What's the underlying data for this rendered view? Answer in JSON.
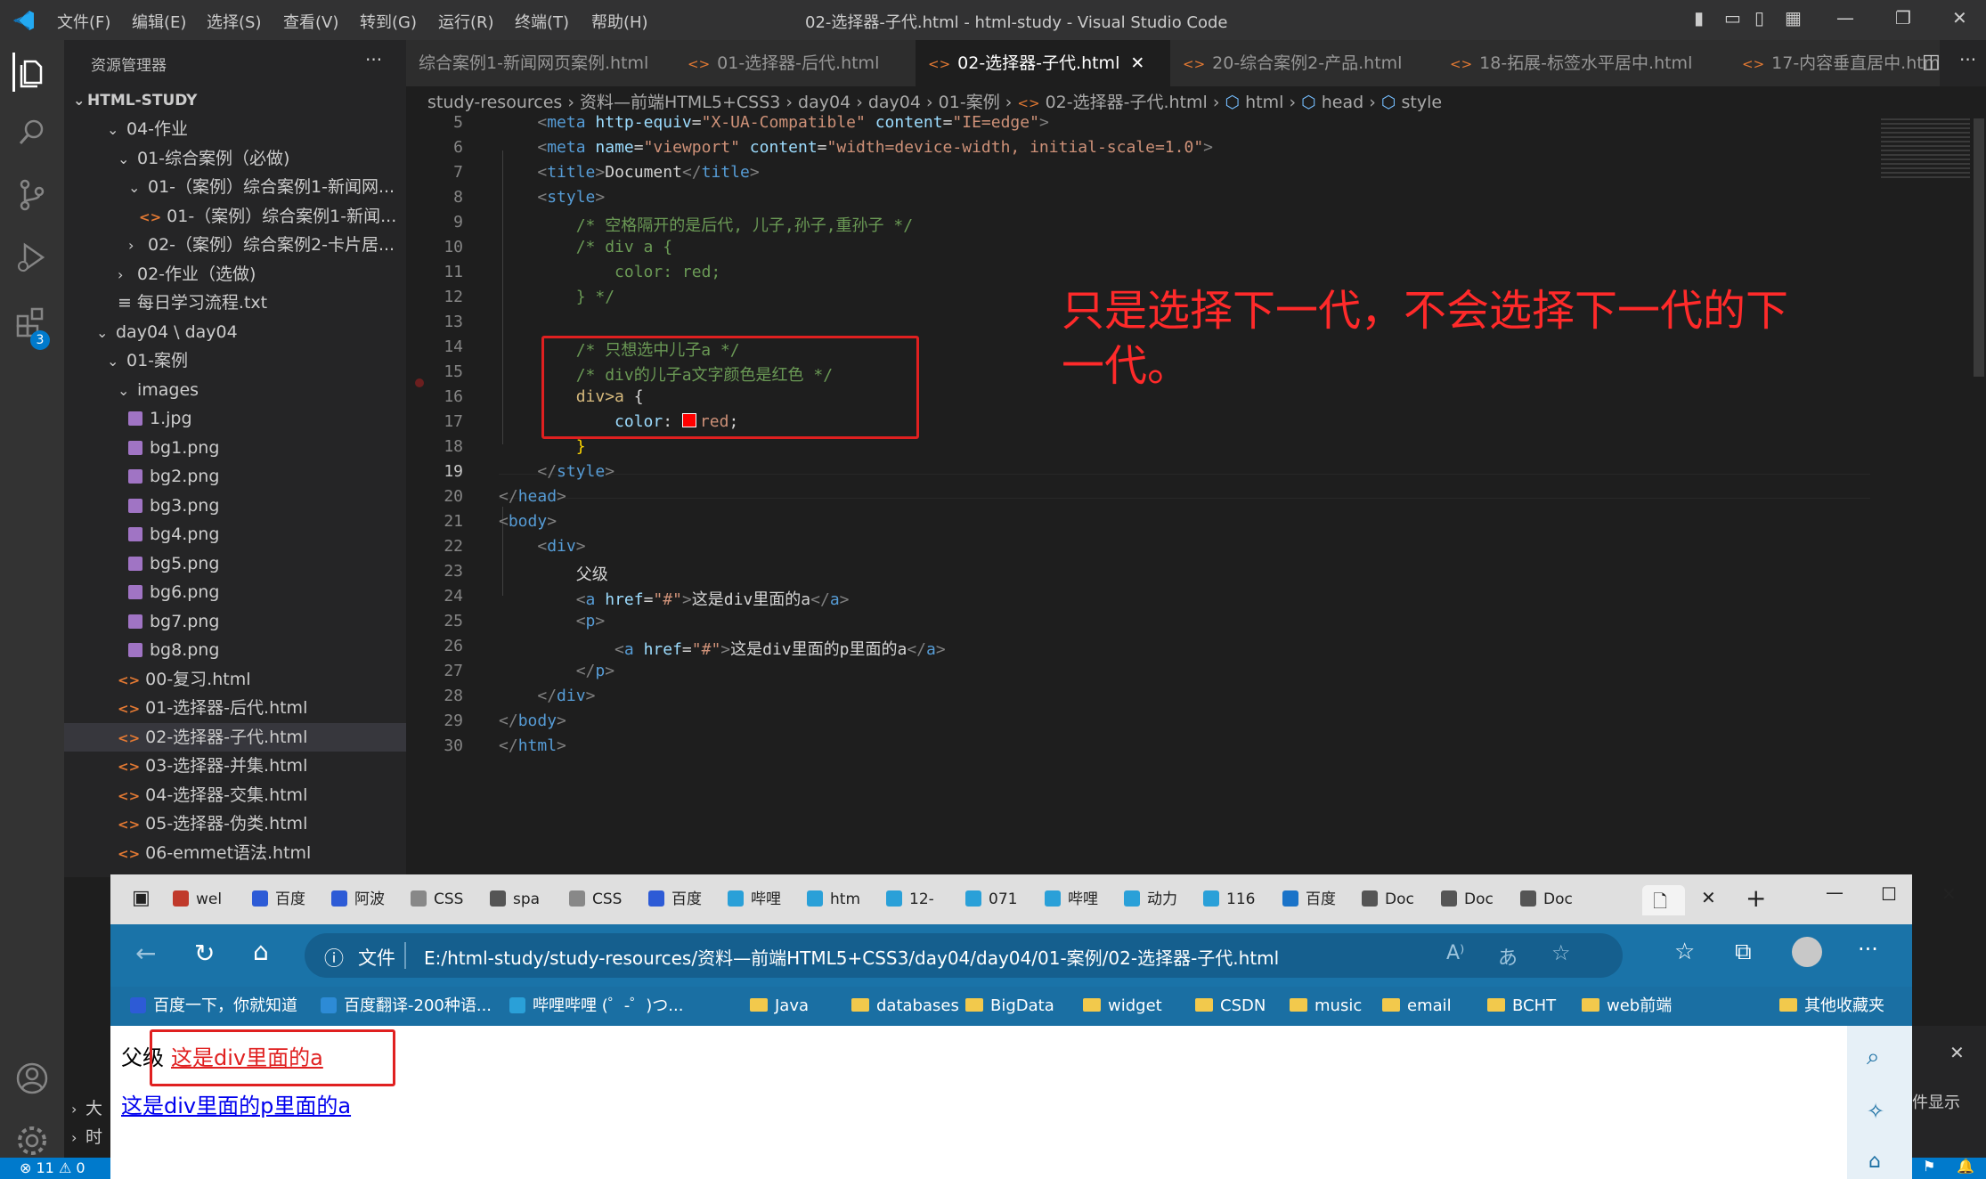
{
  "window": {
    "title": "02-选择器-子代.html - html-study - Visual Studio Code",
    "menu": [
      "文件(F)",
      "编辑(E)",
      "选择(S)",
      "查看(V)",
      "转到(G)",
      "运行(R)",
      "终端(T)",
      "帮助(H)"
    ]
  },
  "activity_bar": {
    "badge": "3"
  },
  "sidebar": {
    "header": "资源管理器",
    "more": "···",
    "root": "HTML-STUDY",
    "items": [
      {
        "label": "04-作业",
        "type": "folder"
      },
      {
        "label": "01-综合案例（必做)",
        "type": "folder"
      },
      {
        "label": "01-（案例）综合案例1-新闻网...",
        "type": "folder"
      },
      {
        "label": "01-（案例）综合案例1-新闻...",
        "type": "html"
      },
      {
        "label": "02-（案例）综合案例2-卡片居...",
        "type": "folder-closed"
      },
      {
        "label": "02-作业（选做)",
        "type": "folder-closed"
      },
      {
        "label": "每日学习流程.txt",
        "type": "txt"
      },
      {
        "label": "day04 \\ day04",
        "type": "folder"
      },
      {
        "label": "01-案例",
        "type": "folder"
      },
      {
        "label": "images",
        "type": "folder"
      },
      {
        "label": "1.jpg",
        "type": "img"
      },
      {
        "label": "bg1.png",
        "type": "img"
      },
      {
        "label": "bg2.png",
        "type": "img"
      },
      {
        "label": "bg3.png",
        "type": "img"
      },
      {
        "label": "bg4.png",
        "type": "img"
      },
      {
        "label": "bg5.png",
        "type": "img"
      },
      {
        "label": "bg6.png",
        "type": "img"
      },
      {
        "label": "bg7.png",
        "type": "img"
      },
      {
        "label": "bg8.png",
        "type": "img"
      },
      {
        "label": "00-复习.html",
        "type": "html"
      },
      {
        "label": "01-选择器-后代.html",
        "type": "html"
      },
      {
        "label": "02-选择器-子代.html",
        "type": "html"
      },
      {
        "label": "03-选择器-并集.html",
        "type": "html"
      },
      {
        "label": "04-选择器-交集.html",
        "type": "html"
      },
      {
        "label": "05-选择器-伪类.html",
        "type": "html"
      },
      {
        "label": "06-emmet语法.html",
        "type": "html"
      }
    ],
    "bottom": [
      "大",
      "时"
    ]
  },
  "tabs": [
    {
      "label": "综合案例1-新闻网页案例.html",
      "active": false
    },
    {
      "label": "01-选择器-后代.html",
      "active": false
    },
    {
      "label": "02-选择器-子代.html",
      "active": true
    },
    {
      "label": "20-综合案例2-产品.html",
      "active": false
    },
    {
      "label": "18-拓展-标签水平居中.html",
      "active": false
    },
    {
      "label": "17-内容垂直居中.htm",
      "active": false
    }
  ],
  "breadcrumb": [
    "study-resources",
    "资料—前端HTML5+CSS3",
    "day04",
    "day04",
    "01-案例",
    "02-选择器-子代.html",
    "html",
    "head",
    "style"
  ],
  "code": {
    "line_numbers": [
      "5",
      "6",
      "7",
      "8",
      "9",
      "10",
      "11",
      "12",
      "13",
      "14",
      "15",
      "16",
      "17",
      "18",
      "19",
      "20",
      "21",
      "22",
      "23",
      "24",
      "25",
      "26",
      "27",
      "28",
      "29",
      "30"
    ],
    "line5": [
      "<",
      "meta",
      " http-equiv",
      "=",
      "\"X-UA-Compatible\"",
      " content",
      "=",
      "\"IE=edge\"",
      ">"
    ],
    "line6": [
      "<",
      "meta",
      " name",
      "=",
      "\"viewport\"",
      " content",
      "=",
      "\"width=device-width, initial-scale=1.0\"",
      ">"
    ],
    "line7": [
      "<",
      "title",
      ">",
      "Document",
      "</",
      "title",
      ">"
    ],
    "line8": [
      "<",
      "style",
      ">"
    ],
    "line9": "/* 空格隔开的是后代, 儿子,孙子,重孙子 */",
    "line10": "/* div a {",
    "line11": "color: red;",
    "line12": "} */",
    "line14": "/* 只想选中儿子a */",
    "line15": "/* div的儿子a文字颜色是红色 */",
    "line16": [
      "div>a",
      " {"
    ],
    "line17": [
      "color",
      ": ",
      "red",
      ";"
    ],
    "line18": "}",
    "line19": [
      "</",
      "style",
      ">"
    ],
    "line20": [
      "</",
      "head",
      ">"
    ],
    "line21": [
      "<",
      "body",
      ">"
    ],
    "line22": [
      "<",
      "div",
      ">"
    ],
    "line23": "父级",
    "line24": [
      "<",
      "a",
      " href",
      "=",
      "\"#\"",
      ">",
      "这是div里面的a",
      "</",
      "a",
      ">"
    ],
    "line25": [
      "<",
      "p",
      ">"
    ],
    "line26": [
      "<",
      "a",
      " href",
      "=",
      "\"#\"",
      ">",
      "这是div里面的p里面的a",
      "</",
      "a",
      ">"
    ],
    "line27": [
      "</",
      "p",
      ">"
    ],
    "line28": [
      "</",
      "div",
      ">"
    ],
    "line29": [
      "</",
      "body",
      ">"
    ],
    "line30": [
      "</",
      "html",
      ">"
    ]
  },
  "annotation": "只是选择下一代，不会选择下一代的下一代。",
  "browser": {
    "tabs": [
      "wel",
      "百度",
      "阿波",
      "CSS",
      "spa",
      "CSS",
      "百度",
      "哔哩",
      "htm",
      "12-",
      "071",
      "哔哩",
      "动力",
      "116",
      "百度",
      "Doc",
      "Doc",
      "Doc"
    ],
    "address_label": "文件",
    "address": "E:/html-study/study-resources/资料—前端HTML5+CSS3/day04/day04/01-案例/02-选择器-子代.html",
    "favorites": [
      "百度一下，你就知道",
      "百度翻译-200种语...",
      "哔哩哔哩 (゜-゜)つ...",
      "Java",
      "databases",
      "BigData",
      "widget",
      "CSDN",
      "music",
      "email",
      "BCHT",
      "web前端"
    ],
    "other_favorites": "其他收藏夹",
    "page": {
      "parent_text": "父级",
      "link1": "这是div里面的a",
      "link2": "这是div里面的p里面的a"
    },
    "side_text": "件显示"
  },
  "status": {
    "errors": "11",
    "warnings": "0"
  }
}
